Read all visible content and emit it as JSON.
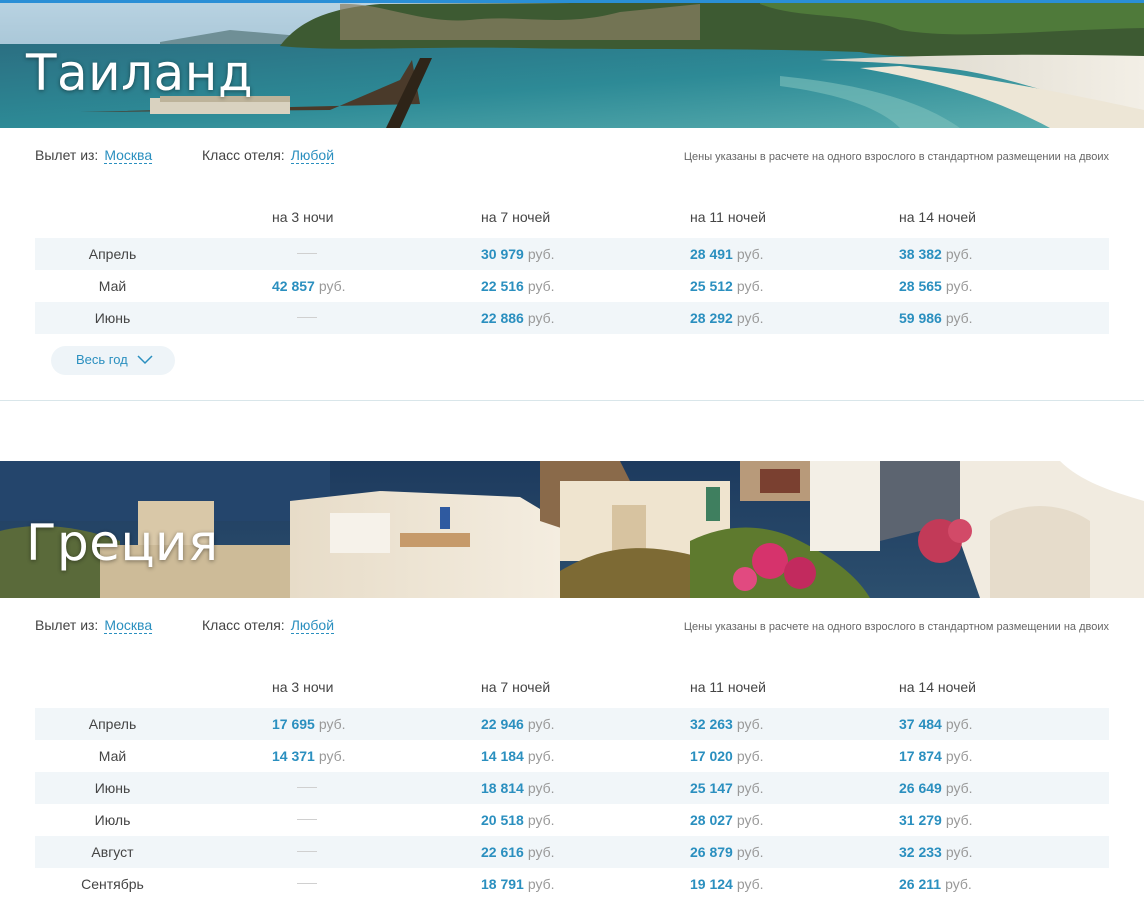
{
  "colors": {
    "accent": "#2a8fbf",
    "row_alt": "#f1f6f9",
    "topline": "#2a8fd6"
  },
  "icons": {
    "expand": "chevron-down-icon"
  },
  "sections": [
    {
      "title": "Таиланд",
      "depart_label": "Вылет из:",
      "depart_value": "Москва",
      "hotel_label": "Класс отеля:",
      "hotel_value": "Любой",
      "price_note": "Цены указаны в расчете на одного взрослого в стандартном размещении на двоих",
      "columns": [
        "на 3 ночи",
        "на 7 ночей",
        "на 11 ночей",
        "на 14 ночей"
      ],
      "currency": "руб.",
      "rows": [
        {
          "month": "Апрель",
          "prices": [
            null,
            "30 979",
            "28 491",
            "38 382"
          ]
        },
        {
          "month": "Май",
          "prices": [
            "42 857",
            "22 516",
            "25 512",
            "28 565"
          ]
        },
        {
          "month": "Июнь",
          "prices": [
            null,
            "22 886",
            "28 292",
            "59 986"
          ]
        }
      ],
      "year_button": "Весь год"
    },
    {
      "title": "Греция",
      "depart_label": "Вылет из:",
      "depart_value": "Москва",
      "hotel_label": "Класс отеля:",
      "hotel_value": "Любой",
      "price_note": "Цены указаны в расчете на одного взрослого в стандартном размещении на двоих",
      "columns": [
        "на 3 ночи",
        "на 7 ночей",
        "на 11 ночей",
        "на 14 ночей"
      ],
      "currency": "руб.",
      "rows": [
        {
          "month": "Апрель",
          "prices": [
            "17 695",
            "22 946",
            "32 263",
            "37 484"
          ]
        },
        {
          "month": "Май",
          "prices": [
            "14 371",
            "14 184",
            "17 020",
            "17 874"
          ]
        },
        {
          "month": "Июнь",
          "prices": [
            null,
            "18 814",
            "25 147",
            "26 649"
          ]
        },
        {
          "month": "Июль",
          "prices": [
            null,
            "20 518",
            "28 027",
            "31 279"
          ]
        },
        {
          "month": "Август",
          "prices": [
            null,
            "22 616",
            "26 879",
            "32 233"
          ]
        },
        {
          "month": "Сентябрь",
          "prices": [
            null,
            "18 791",
            "19 124",
            "26 211"
          ]
        }
      ]
    }
  ]
}
